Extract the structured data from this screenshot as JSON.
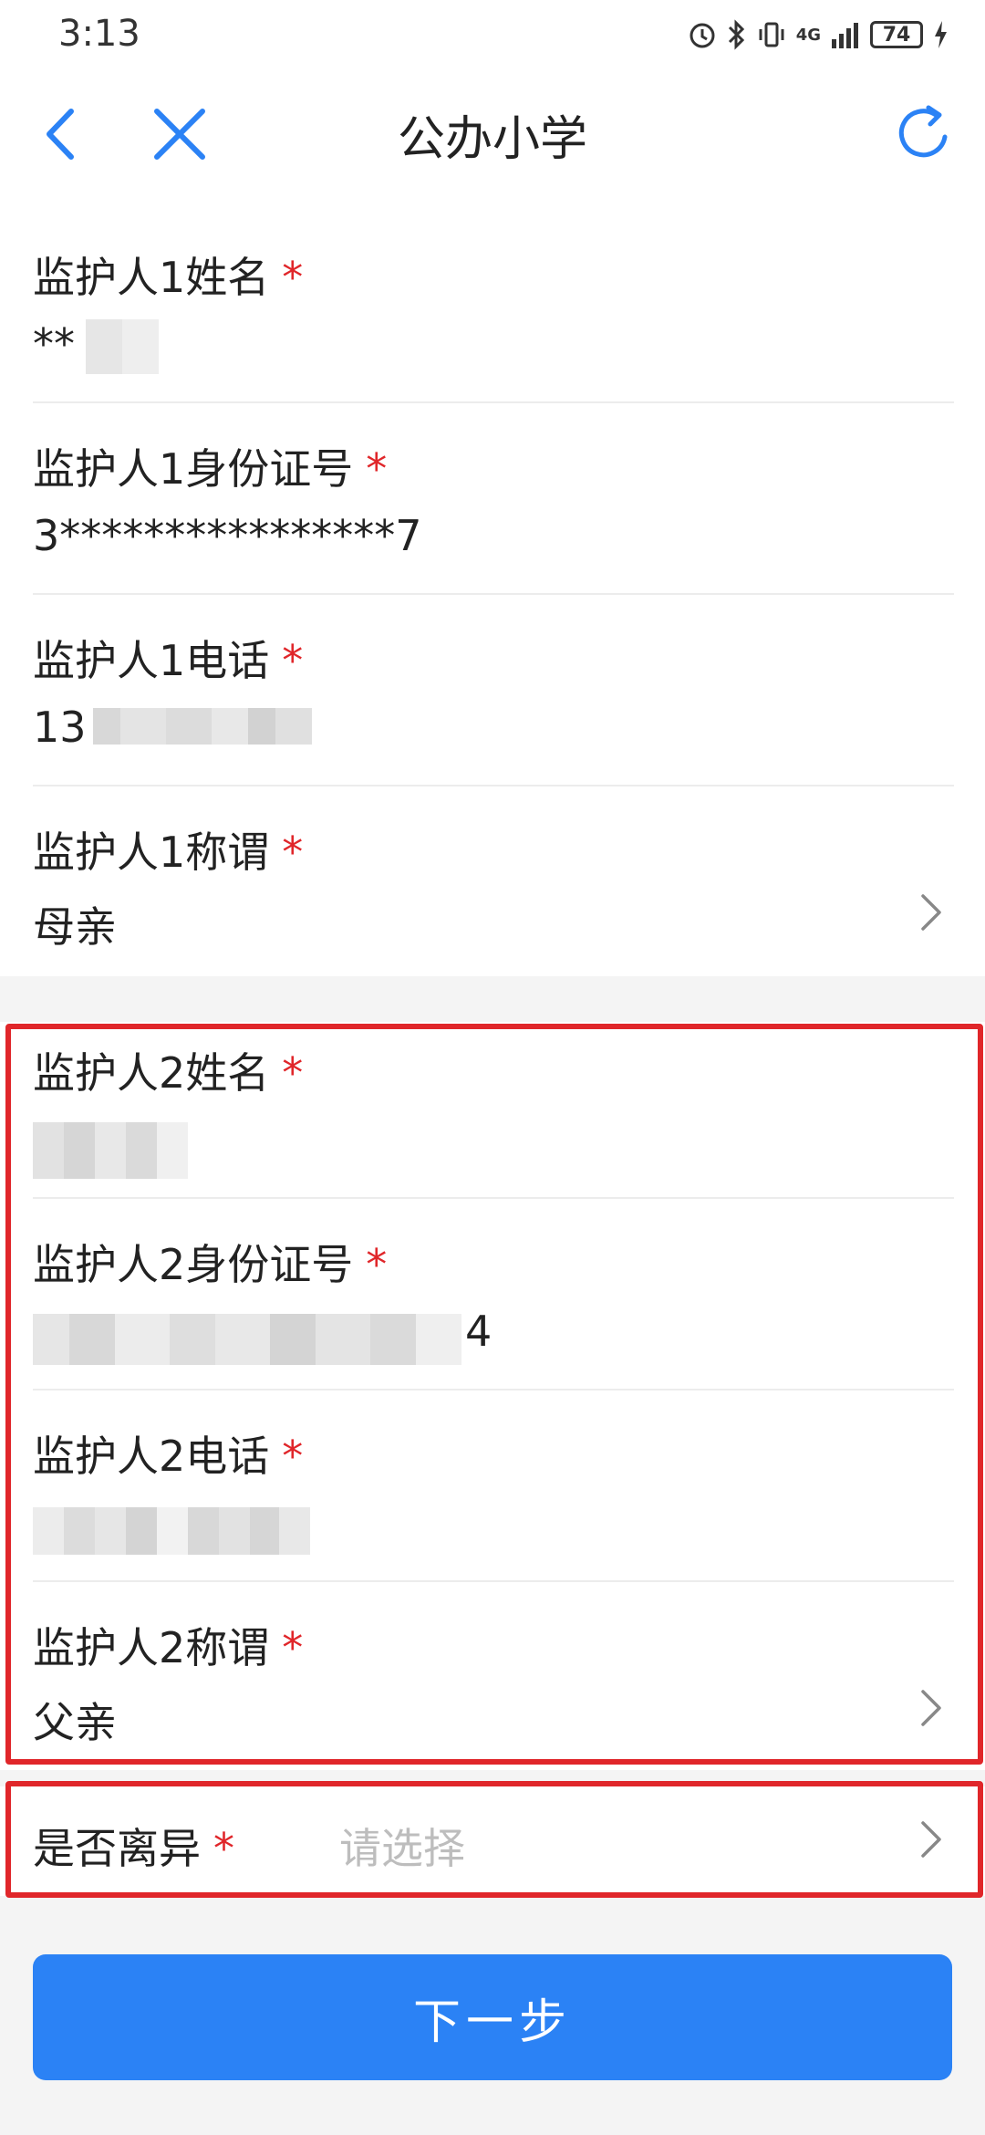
{
  "status_bar": {
    "time": "3:13",
    "network": "4G",
    "battery_level": "74",
    "icons": [
      "alarm-icon",
      "bluetooth-icon",
      "vibrate-icon",
      "signal-icon",
      "battery-icon",
      "charging-icon"
    ]
  },
  "nav": {
    "title": "公办小学",
    "back_icon": "chevron-left-icon",
    "close_icon": "close-icon",
    "refresh_icon": "refresh-icon"
  },
  "guardian1": {
    "name_label": "监护人1姓名",
    "name_value": "**",
    "id_label": "监护人1身份证号",
    "id_value": "3****************7",
    "phone_label": "监护人1电话",
    "phone_value": "13",
    "relation_label": "监护人1称谓",
    "relation_value": "母亲"
  },
  "guardian2": {
    "name_label": "监护人2姓名",
    "id_label": "监护人2身份证号",
    "id_value_tail": "4",
    "phone_label": "监护人2电话",
    "relation_label": "监护人2称谓",
    "relation_value": "父亲"
  },
  "divorce": {
    "label": "是否离异",
    "placeholder": "请选择"
  },
  "required_mark": "*",
  "next_button": "下一步",
  "colors": {
    "accent": "#2b82f5",
    "required": "#e0262a",
    "highlight_border": "#e0262a",
    "placeholder": "#bdbdbd"
  }
}
